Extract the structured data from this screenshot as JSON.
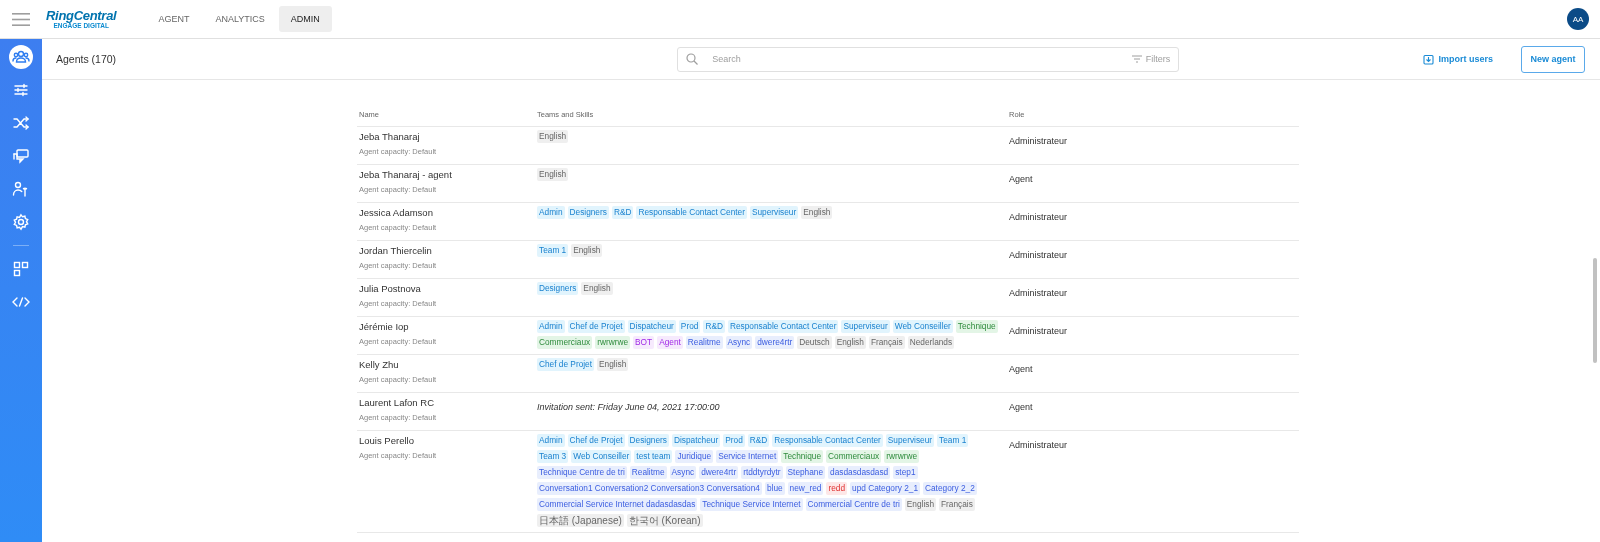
{
  "logo": {
    "name": "RingCentral",
    "subtitle": "ENGAGE DIGITAL"
  },
  "nav_tabs": [
    {
      "label": "AGENT",
      "selected": false
    },
    {
      "label": "ANALYTICS",
      "selected": false
    },
    {
      "label": "ADMIN",
      "selected": true
    }
  ],
  "avatar": {
    "initials": "AA"
  },
  "sidebar": {
    "items": [
      {
        "kind": "users",
        "selected": true
      },
      {
        "kind": "sliders",
        "selected": false
      },
      {
        "kind": "shuffle",
        "selected": false
      },
      {
        "kind": "chat",
        "selected": false
      },
      {
        "kind": "user-tool",
        "selected": false
      },
      {
        "kind": "gear",
        "selected": false
      },
      {
        "kind": "divider"
      },
      {
        "kind": "apps",
        "selected": false
      },
      {
        "kind": "code",
        "selected": false
      }
    ]
  },
  "toolbar": {
    "title": "Agents (170)",
    "search": {
      "placeholder": "Search"
    },
    "filters": "Filters",
    "import": "Import users",
    "new": "New agent"
  },
  "table": {
    "columns": [
      "Name",
      "Teams and Skills",
      "Role"
    ],
    "rows": [
      {
        "name": "Jeba Thanaraj",
        "capacity": "Agent capacity: Default",
        "role": "Administrateur",
        "tags": [
          {
            "label": "English",
            "kind": "language"
          }
        ]
      },
      {
        "name": "Jeba Thanaraj - agent",
        "capacity": "Agent capacity: Default",
        "role": "Agent",
        "tags": [
          {
            "label": "English",
            "kind": "language"
          }
        ]
      },
      {
        "name": "Jessica Adamson",
        "capacity": "Agent capacity: Default",
        "role": "Administrateur",
        "tags": [
          {
            "label": "Admin",
            "kind": "team"
          },
          {
            "label": "Designers",
            "kind": "team"
          },
          {
            "label": "R&D",
            "kind": "team"
          },
          {
            "label": "Responsable Contact Center",
            "kind": "team"
          },
          {
            "label": "Superviseur",
            "kind": "team"
          },
          {
            "label": "English",
            "kind": "language"
          }
        ]
      },
      {
        "name": "Jordan Thiercelin",
        "capacity": "Agent capacity: Default",
        "role": "Administrateur",
        "tags": [
          {
            "label": "Team 1",
            "kind": "team"
          },
          {
            "label": "English",
            "kind": "language"
          }
        ]
      },
      {
        "name": "Julia Postnova",
        "capacity": "Agent capacity: Default",
        "role": "Administrateur",
        "tags": [
          {
            "label": "Designers",
            "kind": "team"
          },
          {
            "label": "English",
            "kind": "language"
          }
        ]
      },
      {
        "name": "Jérémie Iop",
        "capacity": "Agent capacity: Default",
        "role": "Administrateur",
        "tags": [
          {
            "label": "Admin",
            "kind": "team"
          },
          {
            "label": "Chef de Projet",
            "kind": "team"
          },
          {
            "label": "Dispatcheur",
            "kind": "team"
          },
          {
            "label": "Prod",
            "kind": "team"
          },
          {
            "label": "R&D",
            "kind": "team"
          },
          {
            "label": "Responsable Contact Center",
            "kind": "team"
          },
          {
            "label": "Superviseur",
            "kind": "team"
          },
          {
            "label": "Web Conseiller",
            "kind": "team"
          },
          {
            "label": "Technique",
            "kind": "category"
          },
          {
            "label": "Commerciaux",
            "kind": "category"
          },
          {
            "label": "rwrwrwe",
            "kind": "category"
          },
          {
            "label": "BOT",
            "kind": "bot"
          },
          {
            "label": "Agent",
            "kind": "bot"
          },
          {
            "label": "Realitme",
            "kind": "skill"
          },
          {
            "label": "Async",
            "kind": "skill"
          },
          {
            "label": "dwere4rtr",
            "kind": "skill"
          },
          {
            "label": "Deutsch",
            "kind": "language"
          },
          {
            "label": "English",
            "kind": "language"
          },
          {
            "label": "Français",
            "kind": "language"
          },
          {
            "label": "Nederlands",
            "kind": "language"
          }
        ]
      },
      {
        "name": "Kelly Zhu",
        "capacity": "Agent capacity: Default",
        "role": "Agent",
        "tags": [
          {
            "label": "Chef de Projet",
            "kind": "team"
          },
          {
            "label": "English",
            "kind": "language"
          }
        ]
      },
      {
        "name": "Laurent Lafon RC",
        "capacity": "Agent capacity: Default",
        "role": "Agent",
        "invitation": "Invitation sent: Friday June 04, 2021 17:00:00"
      },
      {
        "name": "Louis Perello",
        "capacity": "Agent capacity: Default",
        "role": "Administrateur",
        "tags": [
          {
            "label": "Admin",
            "kind": "team"
          },
          {
            "label": "Chef de Projet",
            "kind": "team"
          },
          {
            "label": "Designers",
            "kind": "team"
          },
          {
            "label": "Dispatcheur",
            "kind": "team"
          },
          {
            "label": "Prod",
            "kind": "team"
          },
          {
            "label": "R&D",
            "kind": "team"
          },
          {
            "label": "Responsable Contact Center",
            "kind": "team"
          },
          {
            "label": "Superviseur",
            "kind": "team"
          },
          {
            "label": "Team 1",
            "kind": "team"
          },
          {
            "label": "Team 3",
            "kind": "team"
          },
          {
            "label": "Web Conseiller",
            "kind": "team"
          },
          {
            "label": "test team",
            "kind": "team"
          },
          {
            "label": "Juridique",
            "kind": "skill"
          },
          {
            "label": "Service Internet",
            "kind": "skill"
          },
          {
            "label": "Technique",
            "kind": "category"
          },
          {
            "label": "Commerciaux",
            "kind": "category"
          },
          {
            "label": "rwrwrwe",
            "kind": "category"
          },
          {
            "label": "Technique Centre de tri",
            "kind": "skill"
          },
          {
            "label": "Realitme",
            "kind": "skill"
          },
          {
            "label": "Async",
            "kind": "skill"
          },
          {
            "label": "dwere4rtr",
            "kind": "skill"
          },
          {
            "label": "rtddtyrdytr",
            "kind": "skill"
          },
          {
            "label": "Stephane",
            "kind": "skill"
          },
          {
            "label": "dasdasdasdasd",
            "kind": "skill"
          },
          {
            "label": "step1",
            "kind": "skill"
          },
          {
            "label": "Conversation1 Conversation2 Conversation3 Conversation4",
            "kind": "skill"
          },
          {
            "label": "blue",
            "kind": "skill"
          },
          {
            "label": "new_red",
            "kind": "skill"
          },
          {
            "label": "redd",
            "kind": "alert"
          },
          {
            "label": "upd Category 2_1",
            "kind": "skill"
          },
          {
            "label": "Category 2_2",
            "kind": "skill"
          },
          {
            "label": "Commercial Service Internet dadasdasdas",
            "kind": "skill"
          },
          {
            "label": "Technique Service Internet",
            "kind": "skill"
          },
          {
            "label": "Commercial Centre de tri",
            "kind": "skill"
          },
          {
            "label": "English",
            "kind": "language"
          },
          {
            "label": "Français",
            "kind": "language"
          },
          {
            "label": "日本語 (Japanese)",
            "kind": "language"
          },
          {
            "label": "한국어 (Korean)",
            "kind": "language"
          }
        ]
      }
    ]
  }
}
